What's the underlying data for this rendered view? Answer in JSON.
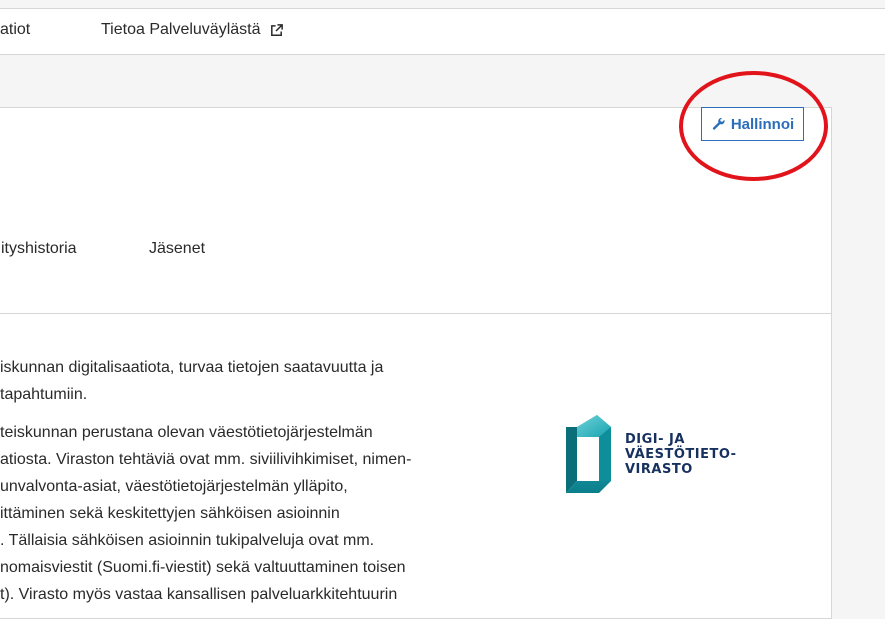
{
  "nav": {
    "item_partial": "atiot",
    "about_label": "Tietoa Palveluväylästä"
  },
  "card": {
    "manage_label": "Hallinnoi",
    "tabs": [
      {
        "label": "ityshistoria"
      },
      {
        "label": "Jäsenet"
      }
    ]
  },
  "content": {
    "paragraph1": [
      "iskunnan digitalisaatiota, turvaa tietojen saatavuutta ja",
      "tapahtumiin."
    ],
    "paragraph2": [
      "teiskunnan perustana olevan väestötietojärjestelmän",
      "atiosta. Viraston tehtäviä ovat mm. siviilivihkimiset, nimen-",
      "unvalvonta-asiat, väestötietojärjestelmän ylläpito,",
      "ittäminen sekä keskitettyjen sähköisen asioinnin",
      ". Tällaisia sähköisen asioinnin tukipalveluja ovat mm.",
      "nomaisviestit (Suomi.fi-viestit) sekä valtuuttaminen toisen",
      "t). Virasto myös vastaa kansallisen palveluarkkitehtuurin"
    ]
  },
  "logo": {
    "lines": [
      "DIGI- JA",
      "VÄESTÖTIETO-",
      "VIRASTO"
    ]
  },
  "colors": {
    "accent": "#2a6ebb",
    "highlight": "#e2141b",
    "logo_text": "#17315f"
  },
  "icons": {
    "about_link": "external-link-icon",
    "manage": "wrench-icon"
  }
}
